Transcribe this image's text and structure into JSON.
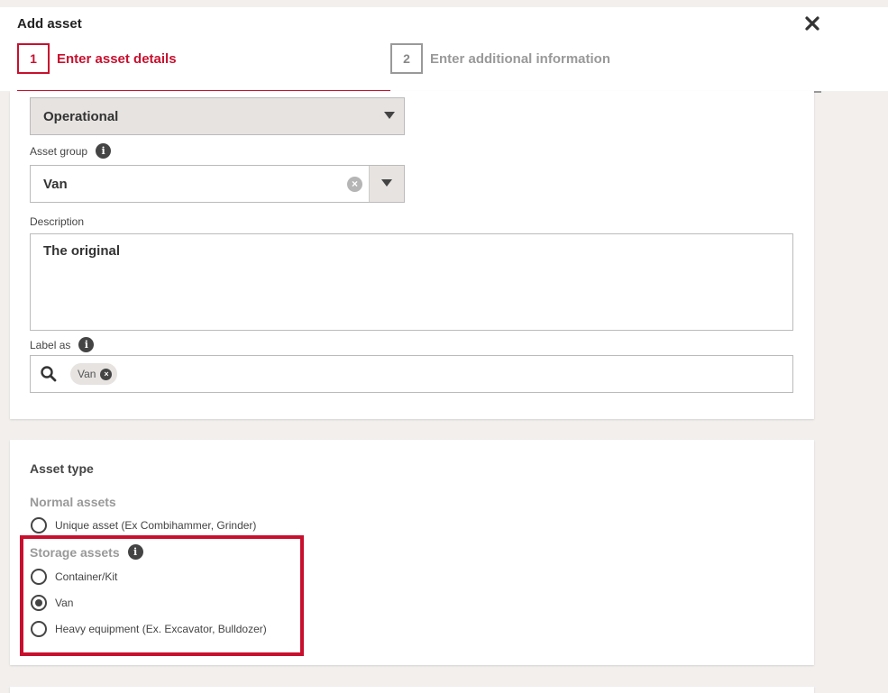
{
  "dialog": {
    "title": "Add asset",
    "steps": [
      {
        "number": "1",
        "label": "Enter asset details",
        "active": true
      },
      {
        "number": "2",
        "label": "Enter additional information",
        "active": false
      }
    ]
  },
  "details": {
    "status_value": "Operational",
    "asset_group_label": "Asset group",
    "asset_group_value": "Van",
    "description_label": "Description",
    "description_value": "The original",
    "label_as_label": "Label as",
    "label_chips": [
      "Van"
    ]
  },
  "asset_type": {
    "title": "Asset type",
    "normal_title": "Normal assets",
    "normal_options": [
      {
        "label": "Unique asset (Ex Combihammer, Grinder)",
        "checked": false
      }
    ],
    "storage_title": "Storage assets",
    "storage_options": [
      {
        "label": "Container/Kit",
        "checked": false
      },
      {
        "label": "Van",
        "checked": true
      },
      {
        "label": "Heavy equipment (Ex. Excavator, Bulldozer)",
        "checked": false
      }
    ]
  },
  "colors": {
    "accent": "#c8102e",
    "background": "#f2efed"
  }
}
